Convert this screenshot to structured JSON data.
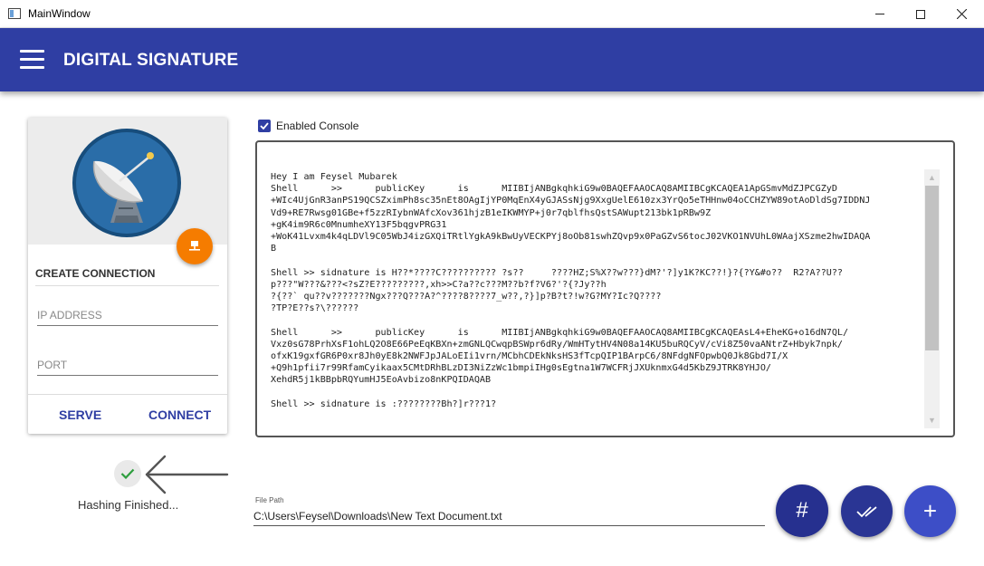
{
  "window": {
    "title": "MainWindow",
    "controls": [
      "minimize",
      "maximize",
      "close"
    ]
  },
  "appbar": {
    "title": "DIGITAL SIGNATURE",
    "menu_icon": "hamburger-menu-icon",
    "color": "#2f3ea3"
  },
  "connection_card": {
    "image_icon": "satellite-dish-icon",
    "action_icon": "network-icon",
    "action_color": "#f57c00",
    "heading": "CREATE CONNECTION",
    "ip_placeholder": "IP ADDRESS",
    "ip_value": "",
    "port_placeholder": "PORT",
    "port_value": "",
    "serve_label": "SERVE",
    "connect_label": "CONNECT"
  },
  "status": {
    "icon": "check-icon",
    "text": "Hashing Finished..."
  },
  "console": {
    "toggle_label": "Enabled Console",
    "enabled": true,
    "text": "Hey I am Feysel Mubarek\nShell      >>      publicKey      is      MIIBIjANBgkqhkiG9w0BAQEFAAOCAQ8AMIIBCgKCAQEA1ApGSmvMdZJPCGZyD\n+WIc4UjGnR3anPS19QCSZximPh8sc35nEt8OAgIjYP0MqEnX4yGJASsNjg9XxgUelE610zx3YrQo5eTHHnw04oCCHZYW89otAoDldSg7IDDNJ\nVd9+RE7Rwsg01GBe+f5zzRIybnWAfcXov361hjzB1eIKWMYP+j0r7qblfhsQstSAWupt213bk1pRBw9Z\n+gK4im9R6c0MnumheXY13F5bqgvPRG31\n+WoK41Lvxm4k4qLDVl9C05WbJ4izGXQiTRtlYgkA9kBwUyVECKPYj8oOb81swhZQvp9x0PaGZvS6tocJ02VKO1NVUhL0WAajXSzme2hwIDAQA\nB\n\nShell >> sidnature is H??*????C?????????? ?s??     ????HZ;S%X??w???}dM?'?]y1K?KC??!}?{?Y&#o??  R2?A??U??\np???\"W???&???<?sZ?E?????????,xh>>C?a??c???M??b?f?V6?'?{?Jy??h\n?{??` qu??v???????Ngx???Q???A?^????8????7_w??,?}]p?B?t?!w?G?MY?Ic?Q????\n?TP?E??s?\\??????\n\nShell      >>      publicKey      is      MIIBIjANBgkqhkiG9w0BAQEFAAOCAQ8AMIIBCgKCAQEAsL4+EheKG+o16dN7QL/\nVxz0sG78PrhXsF1ohLQ2O8E66PeEqKBXn+zmGNLQCwqpBSWpr6dRy/WmHTytHV4N08a14KU5buRQCyV/cVi8Z50vaANtrZ+Hbyk7npk/\nofxK19gxfGR6P0xr8Jh0yE8k2NWFJpJALoEIi1vrn/MCbhCDEkNksHS3fTcpQIP1BArpC6/8NFdgNFOpwbQ0Jk8Gbd7I/X\n+Q9h1pfii7r99RfamCyikaax5CMtDRhBLzDI3NiZzWc1bmpiIHg0sEgtna1W7WCFRjJXUknmxG4d5KbZ9JTRK8YHJO/\nXehdR5j1kBBpbRQYumHJ5EoAvbizo8nKPQIDAQAB\n\nShell >> sidnature is :????????Bh?]r???1?"
  },
  "file": {
    "label": "File Path",
    "value": "C:\\Users\\Feysel\\Downloads\\New Text Document.txt"
  },
  "fabs": {
    "hash_icon": "hash-icon",
    "verify_icon": "double-check-icon",
    "add_icon": "plus-icon"
  }
}
